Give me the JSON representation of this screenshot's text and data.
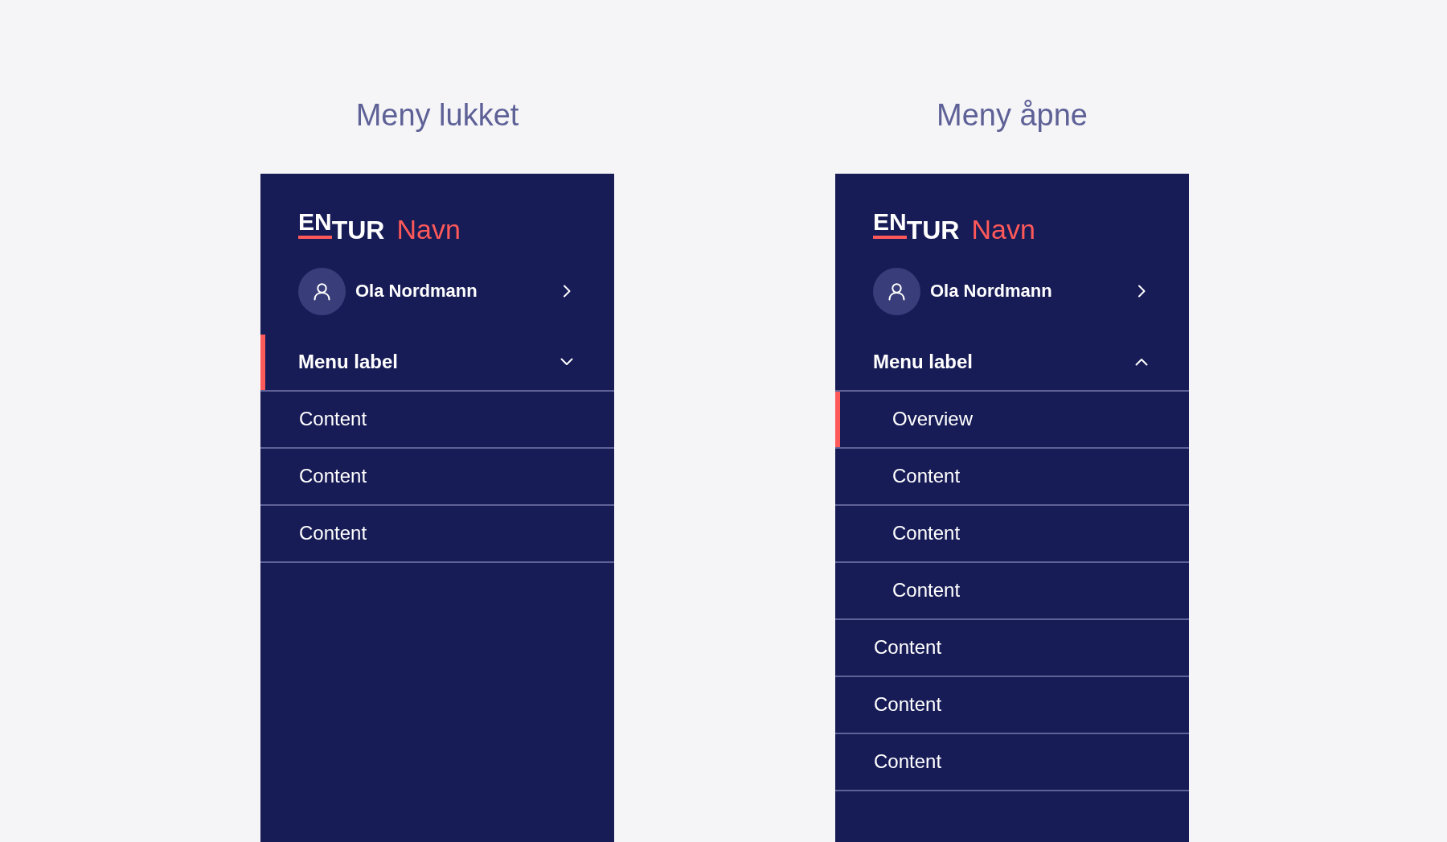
{
  "panels": [
    {
      "title": "Meny lukket",
      "logo": [
        "EN",
        "TUR"
      ],
      "app_name": "Navn",
      "user": {
        "name": "Ola Nordmann"
      },
      "menu": [
        {
          "kind": "group",
          "label": "Menu label",
          "expanded": false,
          "selected": true
        },
        {
          "kind": "link",
          "label": "Content",
          "selected": false
        },
        {
          "kind": "link",
          "label": "Content",
          "selected": false
        },
        {
          "kind": "link",
          "label": "Content",
          "selected": false
        }
      ]
    },
    {
      "title": "Meny åpne",
      "logo": [
        "EN",
        "TUR"
      ],
      "app_name": "Navn",
      "user": {
        "name": "Ola Nordmann"
      },
      "menu": [
        {
          "kind": "group",
          "label": "Menu label",
          "expanded": true,
          "selected": false,
          "children": [
            {
              "label": "Overview",
              "selected": true
            },
            {
              "label": "Content",
              "selected": false
            },
            {
              "label": "Content",
              "selected": false
            },
            {
              "label": "Content",
              "selected": false
            }
          ]
        },
        {
          "kind": "link",
          "label": "Content",
          "selected": false
        },
        {
          "kind": "link",
          "label": "Content",
          "selected": false
        },
        {
          "kind": "link",
          "label": "Content",
          "selected": false
        }
      ]
    }
  ]
}
